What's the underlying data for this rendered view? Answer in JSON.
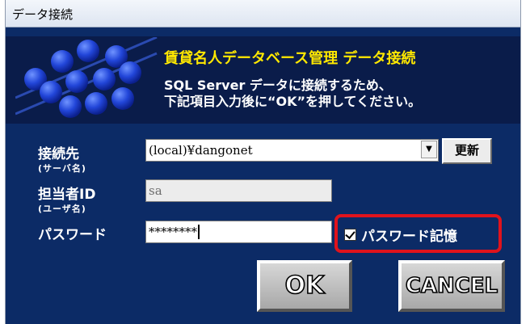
{
  "window": {
    "title": "データ接続"
  },
  "header": {
    "app_title": "賃貸名人データベース管理 データ接続",
    "description_line1": "SQL Server データに接続するため、",
    "description_line2": "下記項目入力後に“OK”を押してください。"
  },
  "form": {
    "server": {
      "label": "接続先",
      "sub_label": "(サーバ名)",
      "value": "(local)¥dangonet",
      "refresh_label": "更新"
    },
    "user": {
      "label": "担当者ID",
      "sub_label": "(ユーザ名)",
      "value": "sa"
    },
    "password": {
      "label": "パスワード",
      "value": "********"
    },
    "remember_password": {
      "label": "パスワード記憶",
      "checked": true
    }
  },
  "buttons": {
    "ok": "OK",
    "cancel": "CANCEL"
  },
  "colors": {
    "dialog_bg": "#0c2b66",
    "title_yellow": "#ffe800",
    "highlight_red": "#e0131c",
    "logo_blue": "#1f3fcf"
  },
  "icons": {
    "logo": "blue-spheres-logo",
    "dropdown": "chevron-down-icon",
    "checkbox": "checkmark-icon"
  }
}
